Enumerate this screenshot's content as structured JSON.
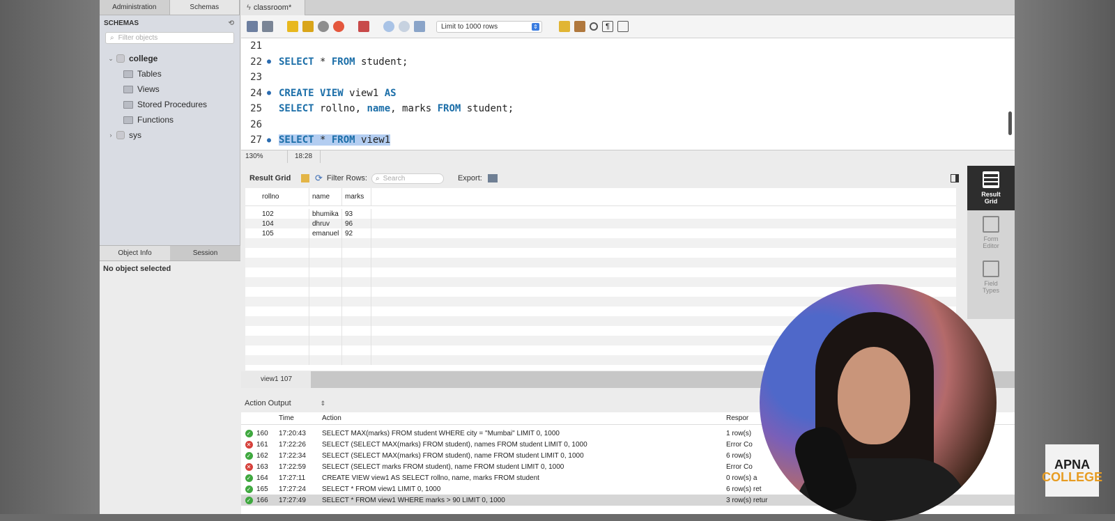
{
  "left_panel": {
    "tabs": [
      "Administration",
      "Schemas"
    ],
    "schemas_header": "SCHEMAS",
    "filter_placeholder": "Filter objects",
    "tree": {
      "db": "college",
      "children": [
        "Tables",
        "Views",
        "Stored Procedures",
        "Functions"
      ],
      "other_db": "sys"
    },
    "info_tabs": [
      "Object Info",
      "Session"
    ],
    "info_text": "No object selected"
  },
  "query_tab": {
    "label": "classroom*"
  },
  "toolbar": {
    "limit_label": "Limit to 1000 rows"
  },
  "editor": {
    "lines": [
      {
        "num": "21",
        "dot": false,
        "tokens": []
      },
      {
        "num": "22",
        "dot": true,
        "tokens": [
          [
            "kw",
            "SELECT"
          ],
          [
            "t",
            " * "
          ],
          [
            "kw",
            "FROM"
          ],
          [
            "t",
            " student;"
          ]
        ]
      },
      {
        "num": "23",
        "dot": false,
        "tokens": []
      },
      {
        "num": "24",
        "dot": true,
        "tokens": [
          [
            "kw",
            "CREATE VIEW"
          ],
          [
            "t",
            " view1 "
          ],
          [
            "kw",
            "AS"
          ]
        ]
      },
      {
        "num": "25",
        "dot": false,
        "tokens": [
          [
            "kw",
            "SELECT"
          ],
          [
            "t",
            " rollno, "
          ],
          [
            "kw",
            "name"
          ],
          [
            "t",
            ", marks "
          ],
          [
            "kw",
            "FROM"
          ],
          [
            "t",
            " student;"
          ]
        ]
      },
      {
        "num": "26",
        "dot": false,
        "tokens": []
      },
      {
        "num": "27",
        "dot": true,
        "selected": true,
        "tokens": [
          [
            "kw",
            "SELECT"
          ],
          [
            "t",
            " * "
          ],
          [
            "kw",
            "FROM"
          ],
          [
            "t",
            " view1"
          ]
        ]
      }
    ],
    "zoom": "130%",
    "cursor_pos": "18:28"
  },
  "result_bar": {
    "title": "Result Grid",
    "filter_label": "Filter Rows:",
    "search_placeholder": "Search",
    "export_label": "Export:"
  },
  "result_grid": {
    "columns": [
      "rollno",
      "name",
      "marks"
    ],
    "rows": [
      [
        "102",
        "bhumika",
        "93"
      ],
      [
        "104",
        "dhruv",
        "96"
      ],
      [
        "105",
        "emanuel",
        "92"
      ]
    ]
  },
  "right_sidebar": [
    {
      "label": "Result Grid",
      "active": true
    },
    {
      "label": "Form Editor",
      "active": false
    },
    {
      "label": "Field Types",
      "active": false
    }
  ],
  "result_tab": "view1 107",
  "action_output": {
    "title": "Action Output",
    "columns": [
      "Time",
      "Action",
      "Respor"
    ],
    "rows": [
      {
        "status": "ok",
        "num": "160",
        "time": "17:20:43",
        "action": "SELECT MAX(marks) FROM student WHERE city = \"Mumbai\" LIMIT 0, 1000",
        "response": "1 row(s)"
      },
      {
        "status": "error",
        "num": "161",
        "time": "17:22:26",
        "action": "SELECT (SELECT MAX(marks) FROM student), names FROM student LIMIT 0, 1000",
        "response": "Error Co"
      },
      {
        "status": "ok",
        "num": "162",
        "time": "17:22:34",
        "action": "SELECT (SELECT MAX(marks) FROM student), name FROM student LIMIT 0, 1000",
        "response": "6 row(s)"
      },
      {
        "status": "error",
        "num": "163",
        "time": "17:22:59",
        "action": "SELECT (SELECT marks FROM student), name FROM student LIMIT 0, 1000",
        "response": "Error Co"
      },
      {
        "status": "ok",
        "num": "164",
        "time": "17:27:11",
        "action": "CREATE VIEW view1 AS SELECT rollno, name, marks FROM student",
        "response": "0 row(s) a"
      },
      {
        "status": "ok",
        "num": "165",
        "time": "17:27:24",
        "action": "SELECT * FROM view1 LIMIT 0, 1000",
        "response": "6 row(s) ret"
      },
      {
        "status": "ok",
        "num": "166",
        "time": "17:27:49",
        "action": "SELECT * FROM view1 WHERE marks > 90 LIMIT 0, 1000",
        "response": "3 row(s) retur"
      }
    ]
  },
  "logo": {
    "line1": "APNA",
    "line2": "COLLEGE"
  }
}
